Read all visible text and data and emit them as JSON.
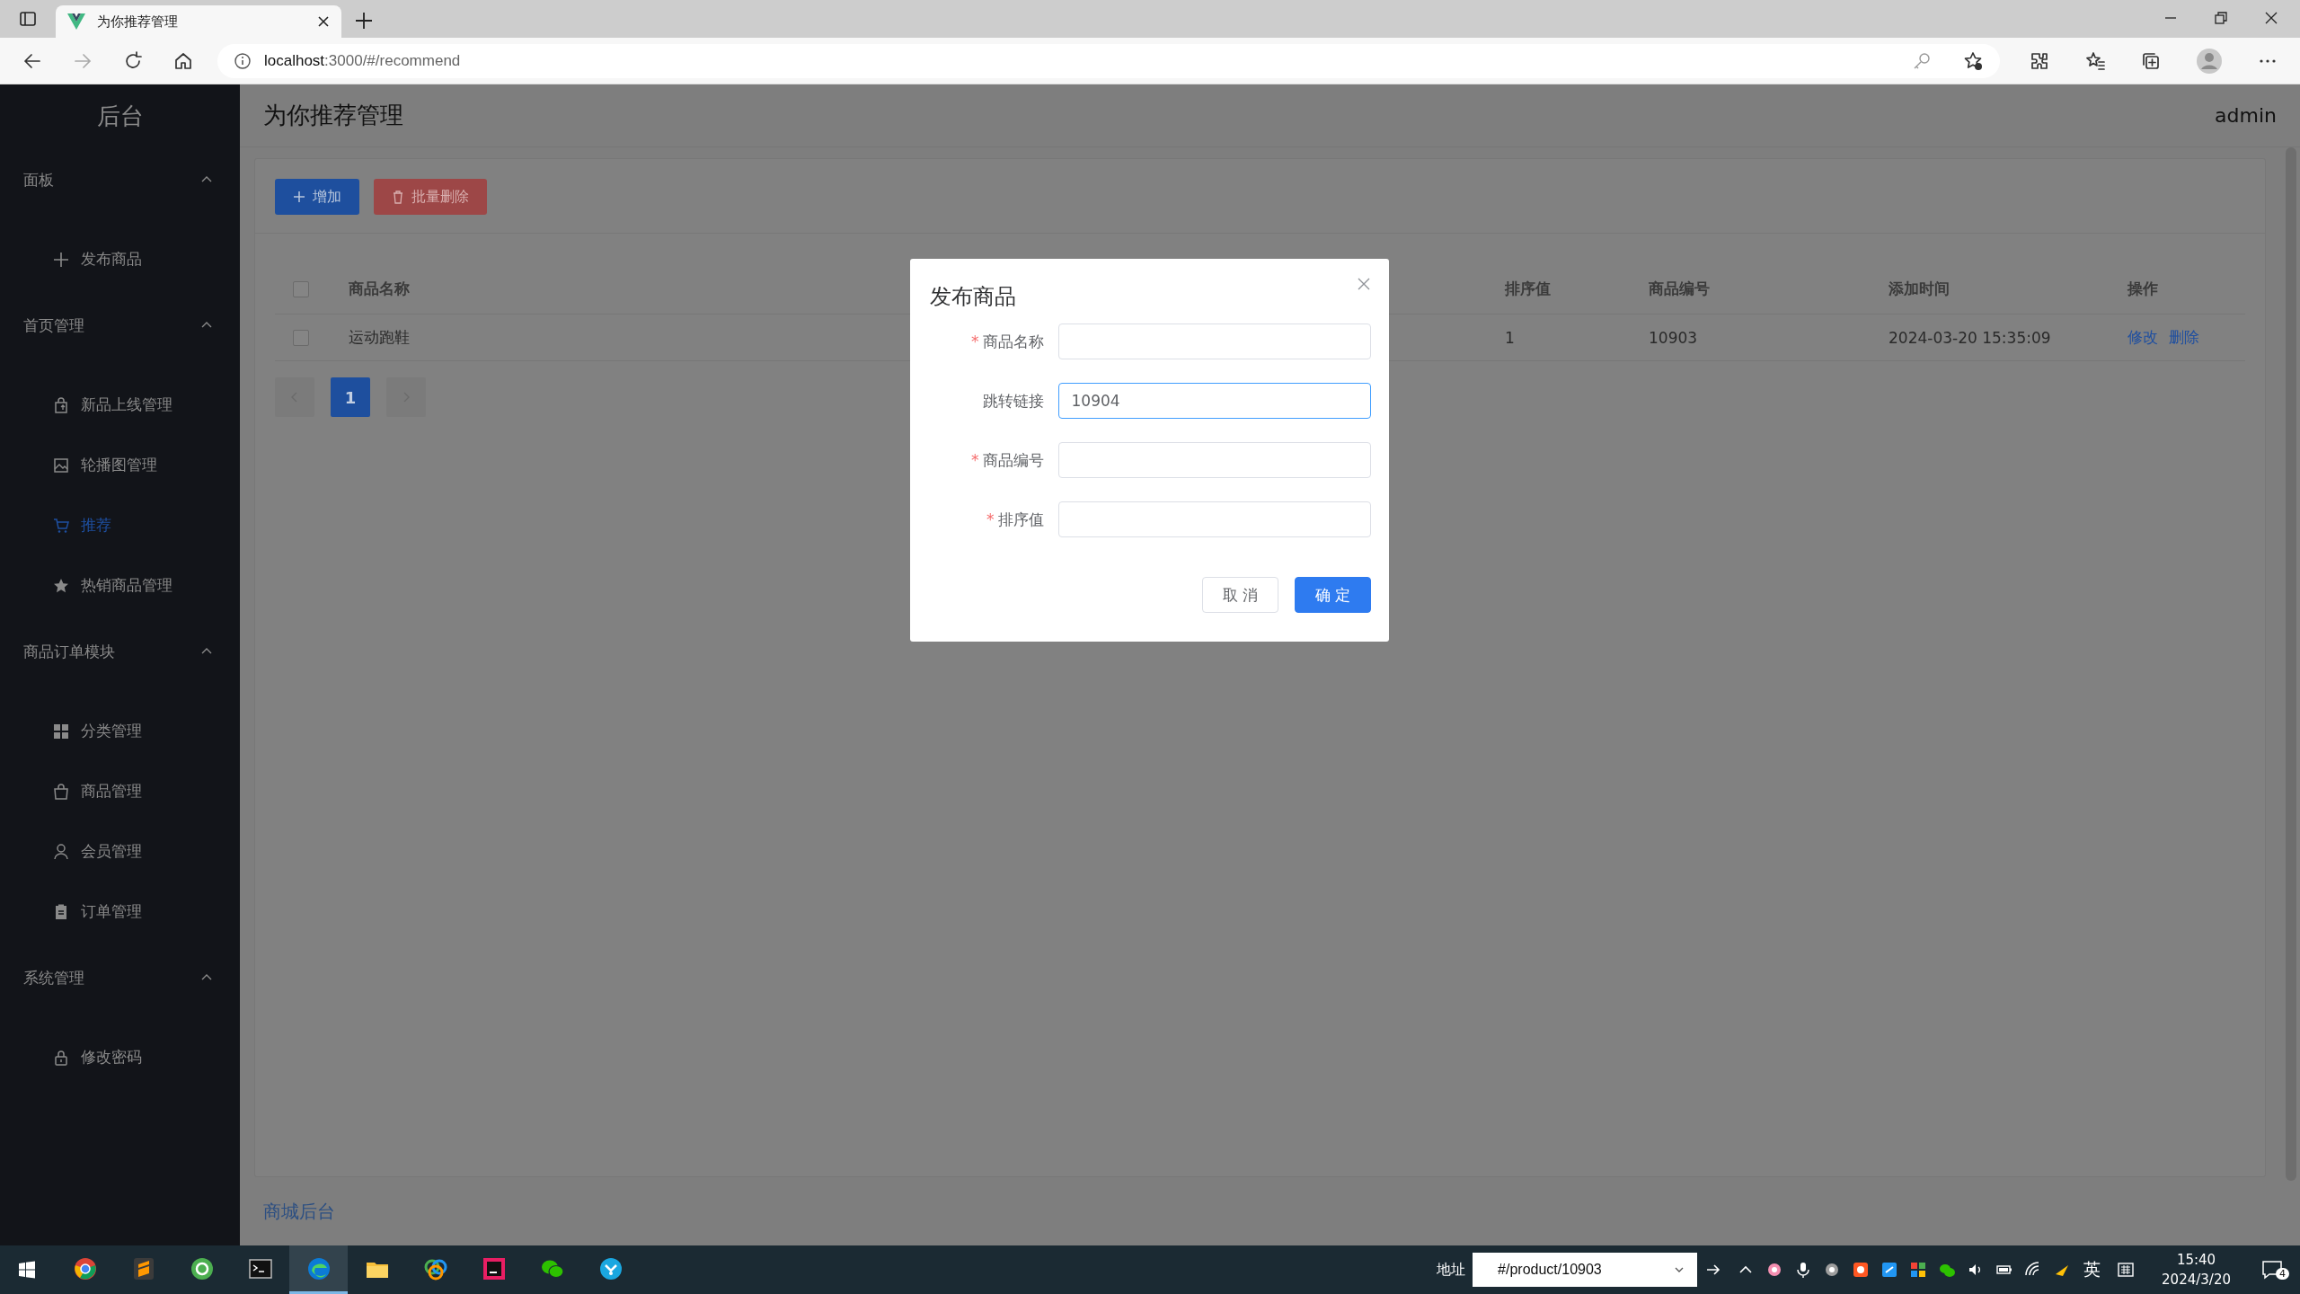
{
  "browser": {
    "tab_title": "为你推荐管理",
    "url_host": "localhost",
    "url_rest": ":3000/#/recommend"
  },
  "app": {
    "brand": "后台",
    "page_title": "为你推荐管理",
    "user": "admin",
    "footer": "商城后台"
  },
  "sidebar": {
    "groups": [
      {
        "label": "面板",
        "expanded": true,
        "items": [
          {
            "label": "发布商品",
            "selected": false
          }
        ]
      },
      {
        "label": "首页管理",
        "expanded": true,
        "items": [
          {
            "label": "新品上线管理",
            "selected": false
          },
          {
            "label": "轮播图管理",
            "selected": false
          },
          {
            "label": "推荐",
            "selected": true
          },
          {
            "label": "热销商品管理",
            "selected": false
          }
        ]
      },
      {
        "label": "商品订单模块",
        "expanded": true,
        "items": [
          {
            "label": "分类管理",
            "selected": false
          },
          {
            "label": "商品管理",
            "selected": false
          },
          {
            "label": "会员管理",
            "selected": false
          },
          {
            "label": "订单管理",
            "selected": false
          }
        ]
      },
      {
        "label": "系统管理",
        "expanded": true,
        "items": [
          {
            "label": "修改密码",
            "selected": false
          }
        ]
      }
    ]
  },
  "toolbar": [
    {
      "label": "增加",
      "kind": "primary"
    },
    {
      "label": "批量删除",
      "kind": "danger"
    }
  ],
  "table": {
    "all_checked": false,
    "columns": [
      "商品名称",
      "排序值",
      "商品编号",
      "添加时间",
      "操作"
    ],
    "rows": [
      {
        "checked": false,
        "cells": [
          "运动跑鞋",
          "1",
          "10903",
          "2024-03-20 15:35:09"
        ],
        "actions": [
          "修改",
          "删除"
        ]
      }
    ]
  },
  "pagination": {
    "pages": [
      {
        "label": "1",
        "selected": true
      }
    ]
  },
  "dialog": {
    "title": "发布商品",
    "fields": [
      {
        "label": "商品名称",
        "required": true,
        "required_mark": "*"
      },
      {
        "label": "跳转链接",
        "required": false,
        "value": "10904",
        "focused": true
      },
      {
        "label": "商品编号",
        "required": true,
        "required_mark": "*"
      },
      {
        "label": "排序值",
        "required": true,
        "required_mark": "*"
      }
    ],
    "buttons": [
      {
        "label": "取 消",
        "kind": "default"
      },
      {
        "label": "确 定",
        "kind": "primary"
      }
    ]
  },
  "taskbar": {
    "apps": [
      {
        "selected": false
      },
      {
        "selected": false
      },
      {
        "selected": false
      },
      {
        "selected": false
      },
      {
        "selected": true
      },
      {
        "selected": false
      },
      {
        "selected": false
      },
      {
        "selected": false
      },
      {
        "selected": false
      },
      {
        "selected": false
      }
    ],
    "address_label": "地址",
    "address_value": "#/product/10903",
    "ime": "英",
    "time": "15:40",
    "date": "2024/3/20",
    "notifications": "4"
  }
}
